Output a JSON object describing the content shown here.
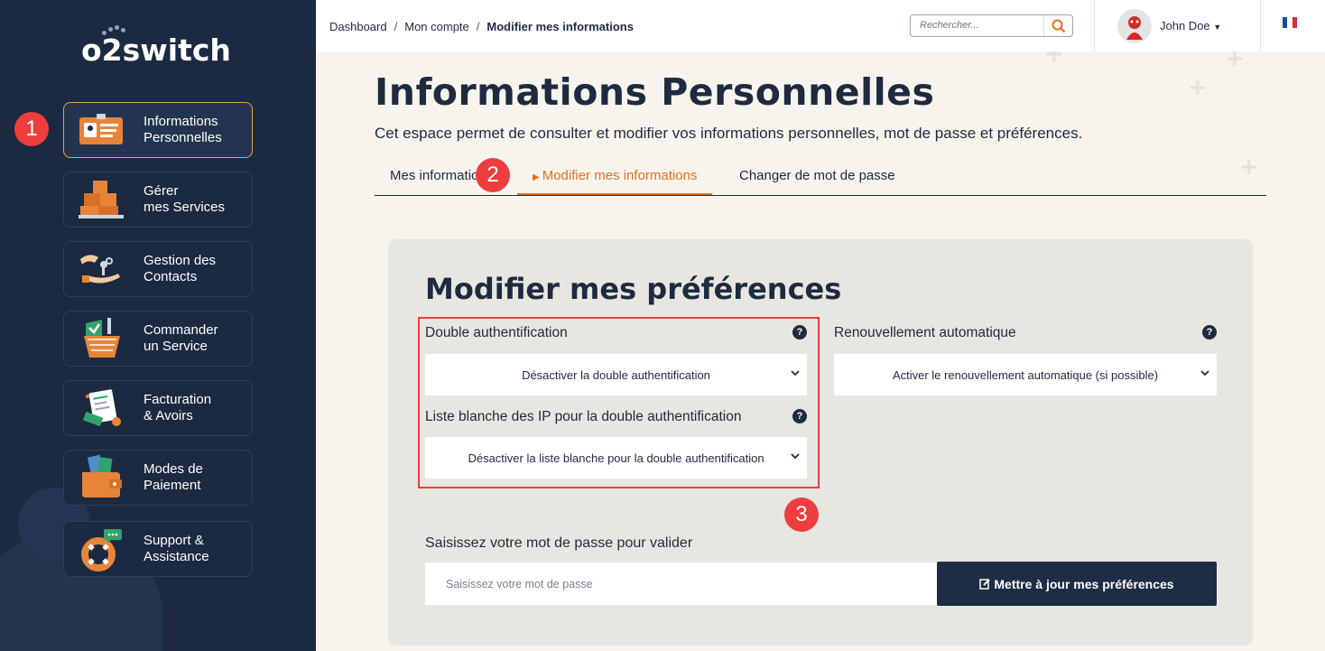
{
  "brand": {
    "logo_text": "o2switch"
  },
  "sidebar": {
    "items": [
      {
        "label": "Informations\nPersonnelles",
        "icon": "id-card-icon",
        "active": true
      },
      {
        "label": "Gérer\nmes Services",
        "icon": "boxes-icon",
        "active": false
      },
      {
        "label": "Gestion des\nContacts",
        "icon": "handshake-keys-icon",
        "active": false
      },
      {
        "label": "Commander\nun Service",
        "icon": "shopping-basket-icon",
        "active": false
      },
      {
        "label": "Facturation\n& Avoirs",
        "icon": "invoice-icon",
        "active": false
      },
      {
        "label": "Modes de\nPaiement",
        "icon": "wallet-icon",
        "active": false
      },
      {
        "label": "Support &\nAssistance",
        "icon": "lifebuoy-icon",
        "active": false
      }
    ]
  },
  "badges": {
    "one": "1",
    "two": "2",
    "three": "3"
  },
  "breadcrumb": {
    "items": [
      "Dashboard",
      "Mon compte"
    ],
    "current": "Modifier mes informations",
    "separator": "/"
  },
  "search": {
    "placeholder": "Rechercher..."
  },
  "user": {
    "name": "John Doe"
  },
  "page": {
    "title": "Informations Personnelles",
    "description": "Cet espace permet de consulter et modifier vos informations personnelles, mot de passe et préférences."
  },
  "tabs": [
    {
      "label": "Mes informations",
      "active": false
    },
    {
      "label": "Modifier mes informations",
      "active": true
    },
    {
      "label": "Changer de mot de passe",
      "active": false
    }
  ],
  "form": {
    "title": "Modifier mes préférences",
    "double_auth": {
      "label": "Double authentification",
      "value": "Désactiver la double authentification"
    },
    "ip_whitelist": {
      "label": "Liste blanche des IP pour la double authentification",
      "value": "Désactiver la liste blanche pour la double authentification"
    },
    "auto_renew": {
      "label": "Renouvellement automatique",
      "value": "Activer le renouvellement automatique (si possible)"
    },
    "help_symbol": "?",
    "password": {
      "label": "Saisissez votre mot de passe pour valider",
      "placeholder": "Saisissez votre mot de passe"
    },
    "submit_label": "Mettre à jour mes préférences"
  },
  "colors": {
    "sidebar_bg": "#1b2a41",
    "accent": "#ea6e1c",
    "badge": "#ef3d3d",
    "highlight_border": "#e8a44a",
    "button_bg": "#1e2d45"
  }
}
